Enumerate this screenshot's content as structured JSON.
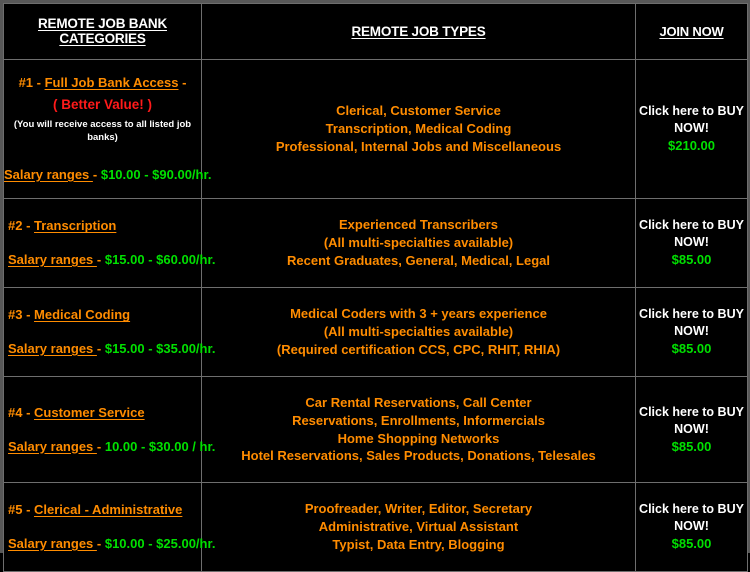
{
  "table": {
    "headers": [
      {
        "label": "REMOTE  JOB BANK CATEGORIES"
      },
      {
        "label": "REMOTE JOB TYPES"
      },
      {
        "label": "JOIN NOW"
      }
    ],
    "rows": [
      {
        "number": "#1 - ",
        "title": "Full Job Bank Access",
        "title_suffix": " -",
        "better_value": "( Better Value! )",
        "note": "(You will receive access to all listed job banks)",
        "salary_label": "Salary ranges ",
        "salary_dash": "- ",
        "salary_amount": "$10.00 - $90.00/hr.",
        "job_types": [
          "Clerical, Customer Service",
          "Transcription, Medical Coding",
          "Professional, Internal Jobs and Miscellaneous"
        ],
        "cta_line1": "Click here to BUY",
        "cta_line2": "NOW!",
        "price": "$210.00"
      },
      {
        "number": "#2 - ",
        "title": "Transcription",
        "title_suffix": " ",
        "better_value": "",
        "note": "",
        "salary_label": "Salary ranges ",
        "salary_dash": "- ",
        "salary_amount": "$15.00 - $60.00/hr.",
        "job_types": [
          "Experienced Transcribers",
          "(All multi-specialties available)",
          "Recent Graduates, General, Medical, Legal"
        ],
        "cta_line1": "Click here to BUY",
        "cta_line2": "NOW!",
        "price": "$85.00"
      },
      {
        "number": "#3 - ",
        "title": "Medical Coding",
        "title_suffix": "",
        "better_value": "",
        "note": "",
        "salary_label": "Salary ranges ",
        "salary_dash": "- ",
        "salary_amount": "$15.00 - $35.00/hr.",
        "job_types": [
          "Medical Coders with 3 + years experience",
          "(All multi-specialties available)",
          "(Required certification CCS, CPC, RHIT, RHIA)"
        ],
        "cta_line1": "Click here to BUY",
        "cta_line2": "NOW!",
        "price": "$85.00"
      },
      {
        "number": "#4 - ",
        "title": "Customer Service",
        "title_suffix": "",
        "better_value": "",
        "note": "",
        "salary_label": "Salary ranges ",
        "salary_dash": "- ",
        "salary_amount": "10.00 - $30.00 / hr.",
        "job_types": [
          "Car Rental Reservations, Call Center",
          "Reservations, Enrollments, Informercials",
          "Home Shopping Networks",
          "Hotel Reservations, Sales Products, Donations, Telesales"
        ],
        "cta_line1": "Click here to BUY",
        "cta_line2": "NOW!",
        "price": "$85.00"
      },
      {
        "number": "#5 - ",
        "title": "Clerical - Administrative",
        "title_suffix": "",
        "better_value": "",
        "note": "",
        "salary_label": "Salary ranges ",
        "salary_dash": "- ",
        "salary_amount": "$10.00 - $25.00/hr.",
        "job_types": [
          "Proofreader, Writer, Editor, Secretary",
          "Administrative, Virtual Assistant",
          "Typist, Data Entry, Blogging"
        ],
        "cta_line1": "Click here to BUY",
        "cta_line2": "NOW!",
        "price": "$85.00"
      }
    ]
  },
  "colors": {
    "background": "#000000",
    "accent_orange": "#ff8c00",
    "price_green": "#00e000",
    "alert_red": "#ff1a1a",
    "header_white": "#ffffff",
    "border_gray": "#6e6e6e"
  }
}
